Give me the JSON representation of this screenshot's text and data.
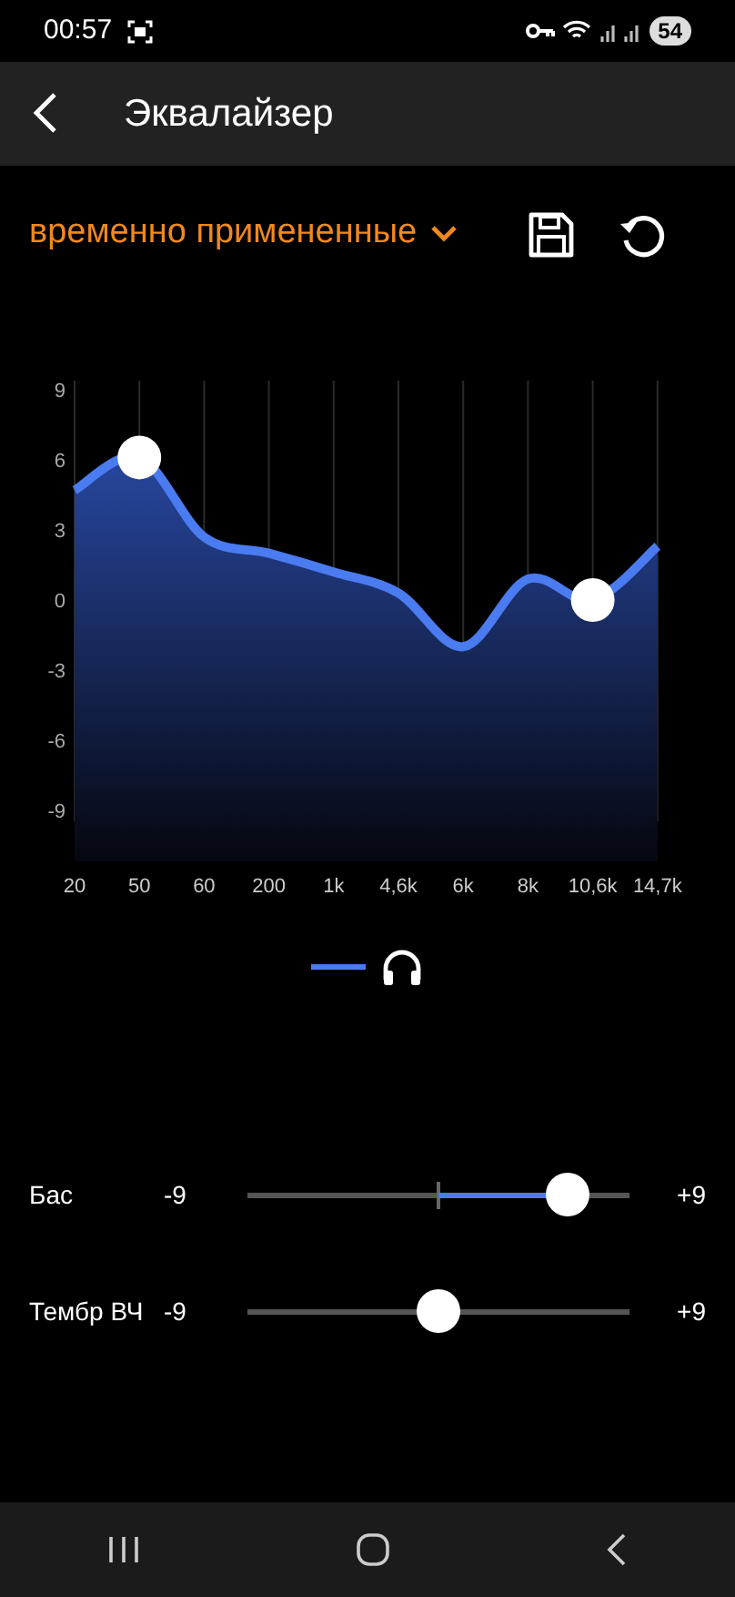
{
  "status_bar": {
    "time": "00:57",
    "battery": "54"
  },
  "header": {
    "title": "Эквалайзер"
  },
  "preset": {
    "label": "временно примененные"
  },
  "equalizer": {
    "chart_data": {
      "type": "area",
      "categories": [
        "20",
        "50",
        "60",
        "200",
        "1k",
        "4,6k",
        "6k",
        "8k",
        "10,6k",
        "14,7k"
      ],
      "ylim": [
        -9,
        9
      ],
      "yticks": [
        9,
        6,
        3,
        0,
        -3,
        -6,
        -9
      ],
      "grid": true,
      "series": [
        {
          "color": "#4a7bf0",
          "values": [
            4.7,
            6.1,
            2.7,
            2.0,
            1.2,
            0.3,
            -2.0,
            0.9,
            0.0,
            2.3
          ]
        }
      ]
    },
    "bands": [
      {
        "handle": false
      },
      {
        "handle": true
      },
      {
        "handle": false
      },
      {
        "handle": false
      },
      {
        "handle": false
      },
      {
        "handle": false
      },
      {
        "handle": false
      },
      {
        "handle": false
      },
      {
        "handle": true
      },
      {
        "handle": false
      }
    ]
  },
  "sliders": [
    {
      "label": "Бас",
      "min": "-9",
      "max": "+9",
      "level": 0.84
    },
    {
      "label": "Тембр ВЧ",
      "min": "-9",
      "max": "+9",
      "level": 0.5
    }
  ]
}
